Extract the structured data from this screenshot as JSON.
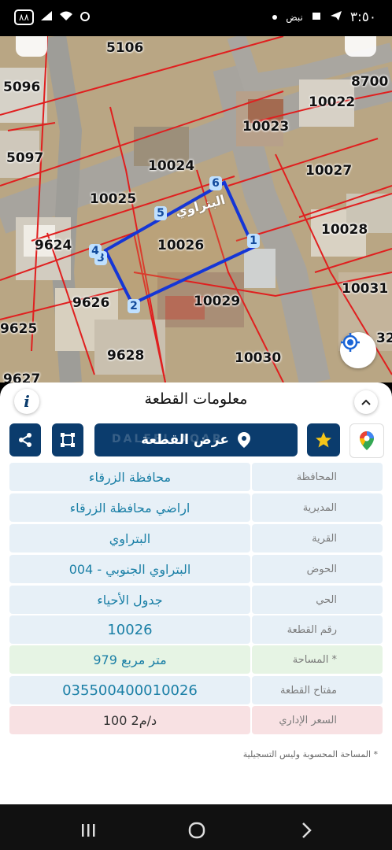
{
  "status": {
    "time": "٣:٥٠",
    "carrier_label": "نبض",
    "battery": "٨٨"
  },
  "map": {
    "road_label": "البتراوي",
    "plots": [
      "5106",
      "5096",
      "5097",
      "8700",
      "10022",
      "10023",
      "10027",
      "10024",
      "10025",
      "10026",
      "10028",
      "9624",
      "10031",
      "9626",
      "10029",
      "9625",
      "9628",
      "10030",
      "9627",
      "32"
    ],
    "vertices": [
      "1",
      "2",
      "3",
      "4",
      "5",
      "6"
    ]
  },
  "sheet": {
    "title": "معلومات القطعة",
    "info_icon_glyph": "i",
    "show_plot_label": "عرض القطعة",
    "watermark": "DALEEL AQAR",
    "rows": [
      {
        "label": "المحافظة",
        "value": "محافظة الزرقاء"
      },
      {
        "label": "المديرية",
        "value": "اراضي محافظة الزرقاء"
      },
      {
        "label": "القرية",
        "value": "البتراوي"
      },
      {
        "label": "الحوض",
        "value": "البتراوي الجنوبي - 004"
      },
      {
        "label": "الحي",
        "value": "جدول الأحياء"
      },
      {
        "label": "رقم القطعة",
        "value": "10026"
      },
      {
        "label": "المساحة *",
        "value": "979  متر مربع"
      },
      {
        "label": "مفتاح القطعة",
        "value": "035500400010026"
      },
      {
        "label": "السعر الإداري",
        "value": "100 د/م2"
      }
    ],
    "note": "* المساحة المحسوبة وليس التسجيلية"
  },
  "colors": {
    "primary": "#0b3c6d",
    "value_text": "#1a7fa6",
    "row_blue": "#e7f0f7",
    "row_green": "#e6f4e4",
    "row_pink": "#f8e1e3",
    "parcel_line": "#e01f1f",
    "selected_plot": "#1536d6"
  },
  "icons": [
    "share-icon",
    "crop-icon",
    "location-pin-icon",
    "star-icon",
    "google-maps-icon",
    "locate-icon",
    "chevron-up-icon",
    "info-icon"
  ]
}
